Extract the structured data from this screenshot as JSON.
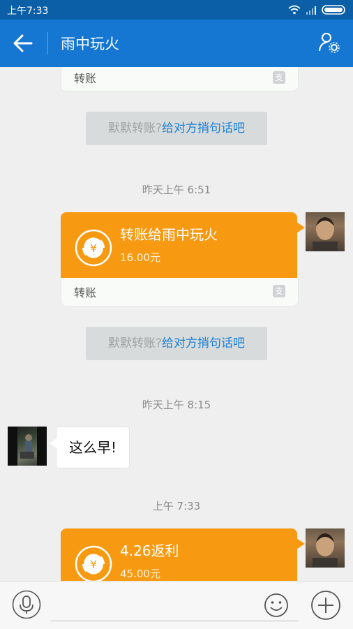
{
  "status_bar": {
    "time": "上午7:33"
  },
  "header": {
    "title": "雨中玩火"
  },
  "messages": {
    "card0_footer": "转账",
    "notice1": {
      "text": "默默转账?",
      "link": "给对方捎句话吧"
    },
    "ts1": "昨天上午 6:51",
    "transfer1": {
      "title": "转账给雨中玩火",
      "amount": "16.00元",
      "footer": "转账"
    },
    "notice2": {
      "text": "默默转账?",
      "link": "给对方捎句话吧"
    },
    "ts2": "昨天上午 8:15",
    "incoming": "这么早!",
    "ts3": "上午 7:33",
    "transfer2": {
      "title": "4.26返利",
      "amount": "45.00元"
    }
  },
  "colors": {
    "accent": "#1677d2",
    "transfer_card": "#f89a11",
    "link": "#1a7fd6"
  },
  "icons": [
    "back-arrow-icon",
    "contact-settings-icon",
    "yuan-exchange-icon",
    "alipay-icon",
    "microphone-icon",
    "emoji-icon",
    "plus-icon"
  ]
}
